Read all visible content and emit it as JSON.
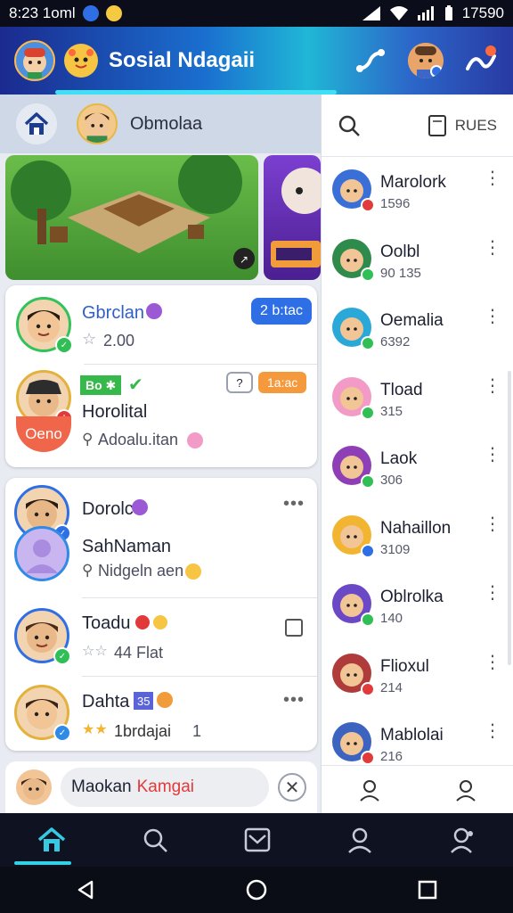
{
  "status_bar": {
    "time": "8:23 1oml",
    "battery_text": "17590"
  },
  "header": {
    "title": "Sosial Ndagaii"
  },
  "left_tab": {
    "channel_name": "Obmolaa"
  },
  "feed": {
    "card1": {
      "row1": {
        "name": "Gbrclan",
        "sub": "2.00",
        "tag": "2 b:tac",
        "accent": "#2f6fe6"
      },
      "row2": {
        "mini_badge": "Bo ✱",
        "pill1": "?",
        "pill2": "1a:ac",
        "tag_text": "Oeno",
        "name": "Horolital",
        "sub": "Adoalu.itan"
      }
    },
    "card2": {
      "row1": {
        "name": "Dorolc",
        "name2": "SahNaman",
        "sub": "Nidgeln aen"
      },
      "row2": {
        "name": "Toadu",
        "sub": "44 Flat"
      },
      "row3": {
        "name": "Dahta",
        "name_badge": "35",
        "sub": "1brdajai",
        "sub_extra": "1"
      }
    },
    "reply": {
      "prefix": "Maokan",
      "highlight": "Kamgai"
    }
  },
  "right_panel": {
    "rules_label": "RUES",
    "items": [
      {
        "name": "Marolork",
        "sub": "1596",
        "avatar_color": "#3a6fd8",
        "badge_color": "#e23a3a"
      },
      {
        "name": "Oolbl",
        "sub": "90 135",
        "avatar_color": "#2e8b4c",
        "badge_color": "#2fbf55"
      },
      {
        "name": "Oemalia",
        "sub": "6392",
        "avatar_color": "#2aa9d8",
        "badge_color": "#2fbf55"
      },
      {
        "name": "Tload",
        "sub": "315",
        "avatar_color": "#f29bc6",
        "badge_color": "#2fbf55"
      },
      {
        "name": "Laok",
        "sub": "306",
        "avatar_color": "#8f3fb5",
        "badge_color": "#2fbf55"
      },
      {
        "name": "Nahaillon",
        "sub": "3109",
        "avatar_color": "#f2b531",
        "badge_color": "#2f6fe6"
      },
      {
        "name": "Oblrolka",
        "sub": "140",
        "avatar_color": "#6a48c6",
        "badge_color": "#2fbf55"
      },
      {
        "name": "Flioxul",
        "sub": "214",
        "avatar_color": "#b03b3b",
        "badge_color": "#e23a3a"
      },
      {
        "name": "Mablolai",
        "sub": "216",
        "avatar_color": "#3c63c0",
        "badge_color": "#e23a3a"
      }
    ]
  }
}
